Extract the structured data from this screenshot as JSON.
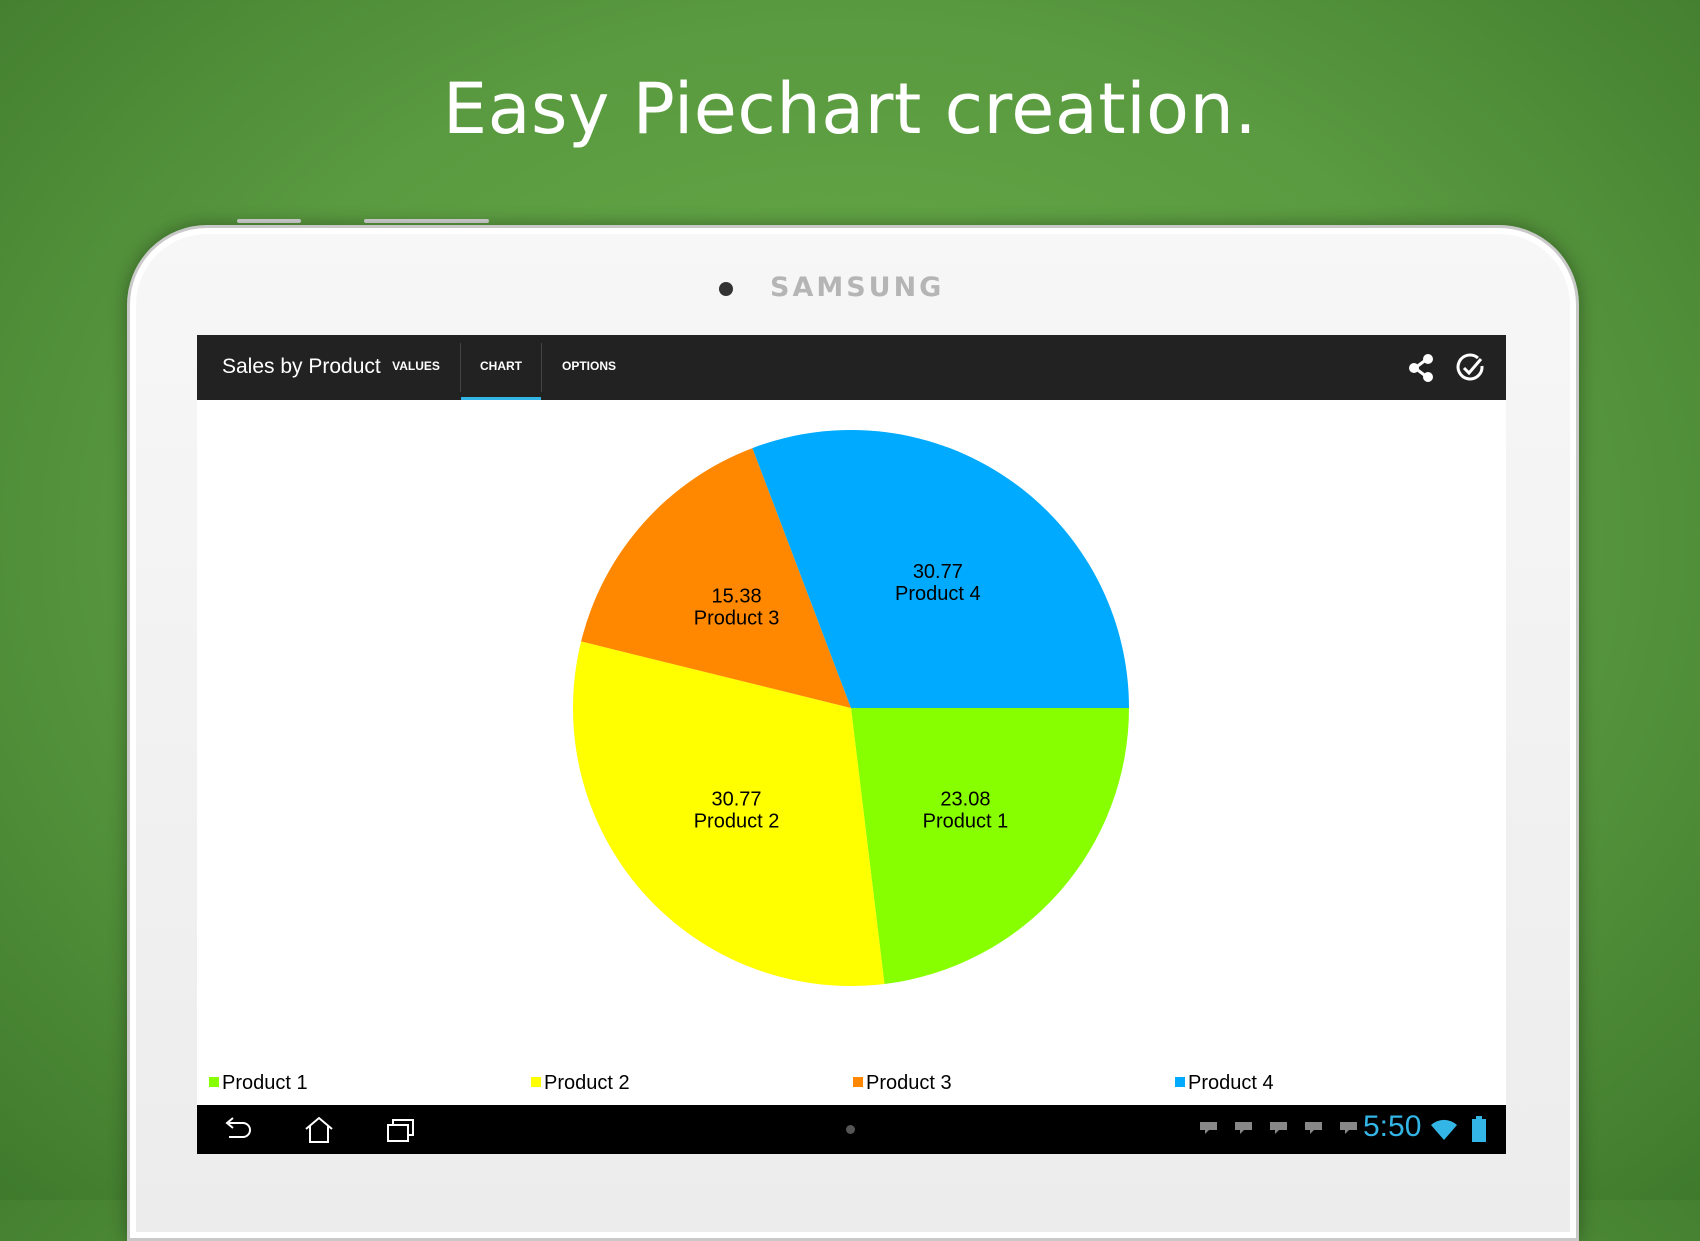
{
  "headline": "Easy Piechart creation.",
  "device": {
    "brand": "SAMSUNG"
  },
  "actionbar": {
    "title": "Sales by Product",
    "tabs": [
      {
        "label": "VALUES",
        "active": false
      },
      {
        "label": "CHART",
        "active": true
      },
      {
        "label": "OPTIONS",
        "active": false
      }
    ],
    "icons": [
      "share-icon",
      "done-icon"
    ]
  },
  "colors": {
    "accent": "#33b5e5",
    "actionbar": "#222222",
    "product1": "#88ff00",
    "product2": "#ffff00",
    "product3": "#ff8800",
    "product4": "#00aaff"
  },
  "chart_data": {
    "type": "pie",
    "title": "",
    "slices": [
      {
        "name": "Product 1",
        "value": 23.08,
        "color": "#88ff00"
      },
      {
        "name": "Product 2",
        "value": 30.77,
        "color": "#ffff00"
      },
      {
        "name": "Product 3",
        "value": 15.38,
        "color": "#ff8800"
      },
      {
        "name": "Product 4",
        "value": 30.77,
        "color": "#00aaff"
      }
    ],
    "labels": [
      {
        "value": "23.08",
        "name": "Product 1"
      },
      {
        "value": "30.77",
        "name": "Product 2"
      },
      {
        "value": "15.38",
        "name": "Product 3"
      },
      {
        "value": "30.77",
        "name": "Product 4"
      }
    ],
    "legend": [
      "Product 1",
      "Product 2",
      "Product 3",
      "Product 4"
    ],
    "legend_position": "bottom"
  },
  "navbar": {
    "icons": [
      "back-icon",
      "home-icon",
      "recent-apps-icon"
    ],
    "time": "5:50"
  }
}
